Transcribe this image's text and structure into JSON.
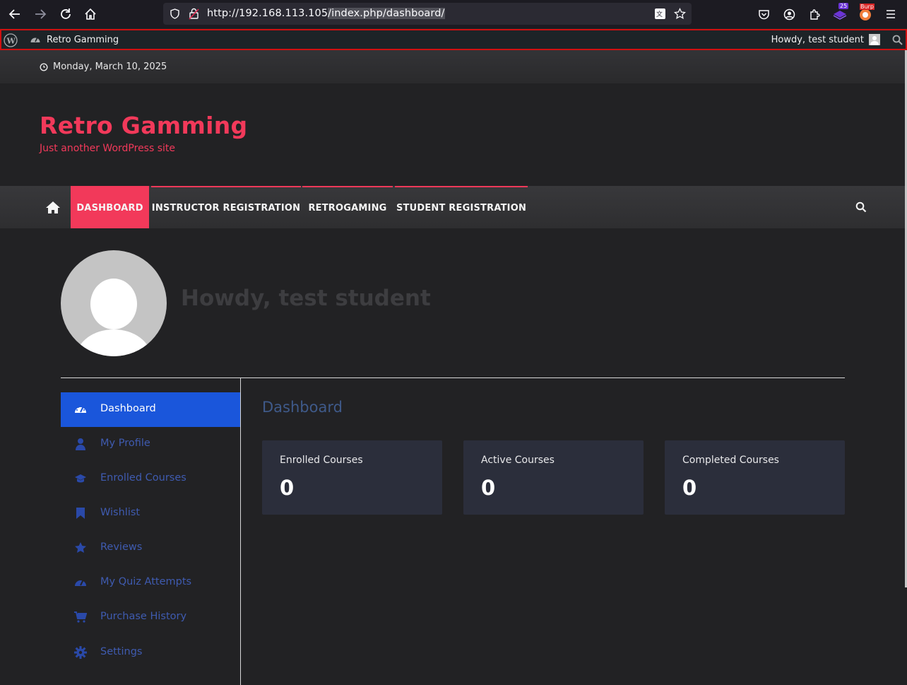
{
  "browser": {
    "url_host": "http://192.168.113.105",
    "url_path": "/index.php/dashboard/",
    "badge_count": "25",
    "burp_label": "Burp"
  },
  "admin_bar": {
    "site_name": "Retro Gamming",
    "howdy": "Howdy, test student"
  },
  "top_strip": {
    "date": "Monday, March 10, 2025"
  },
  "header": {
    "title": "Retro Gamming",
    "tagline": "Just another WordPress site"
  },
  "nav": {
    "items": [
      {
        "label": "DASHBOARD",
        "active": true
      },
      {
        "label": "INSTRUCTOR REGISTRATION",
        "active": false
      },
      {
        "label": "RETROGAMING",
        "active": false
      },
      {
        "label": "STUDENT REGISTRATION",
        "active": false
      }
    ]
  },
  "profile": {
    "greeting": "Howdy, test student"
  },
  "sidebar": {
    "items": [
      {
        "label": "Dashboard",
        "icon": "dashboard-icon",
        "active": true
      },
      {
        "label": "My Profile",
        "icon": "user-icon",
        "active": false
      },
      {
        "label": "Enrolled Courses",
        "icon": "graduation-cap-icon",
        "active": false
      },
      {
        "label": "Wishlist",
        "icon": "bookmark-icon",
        "active": false
      },
      {
        "label": "Reviews",
        "icon": "star-icon",
        "active": false
      },
      {
        "label": "My Quiz Attempts",
        "icon": "quiz-gauge-icon",
        "active": false
      },
      {
        "label": "Purchase History",
        "icon": "cart-icon",
        "active": false
      },
      {
        "label": "Settings",
        "icon": "gear-icon",
        "active": false
      }
    ]
  },
  "main": {
    "title": "Dashboard",
    "stats": [
      {
        "label": "Enrolled Courses",
        "value": "0"
      },
      {
        "label": "Active Courses",
        "value": "0"
      },
      {
        "label": "Completed Courses",
        "value": "0"
      }
    ]
  },
  "colors": {
    "accent": "#f2395a",
    "sidebar_active": "#1a56db",
    "admin_bar": "#1d2327"
  }
}
